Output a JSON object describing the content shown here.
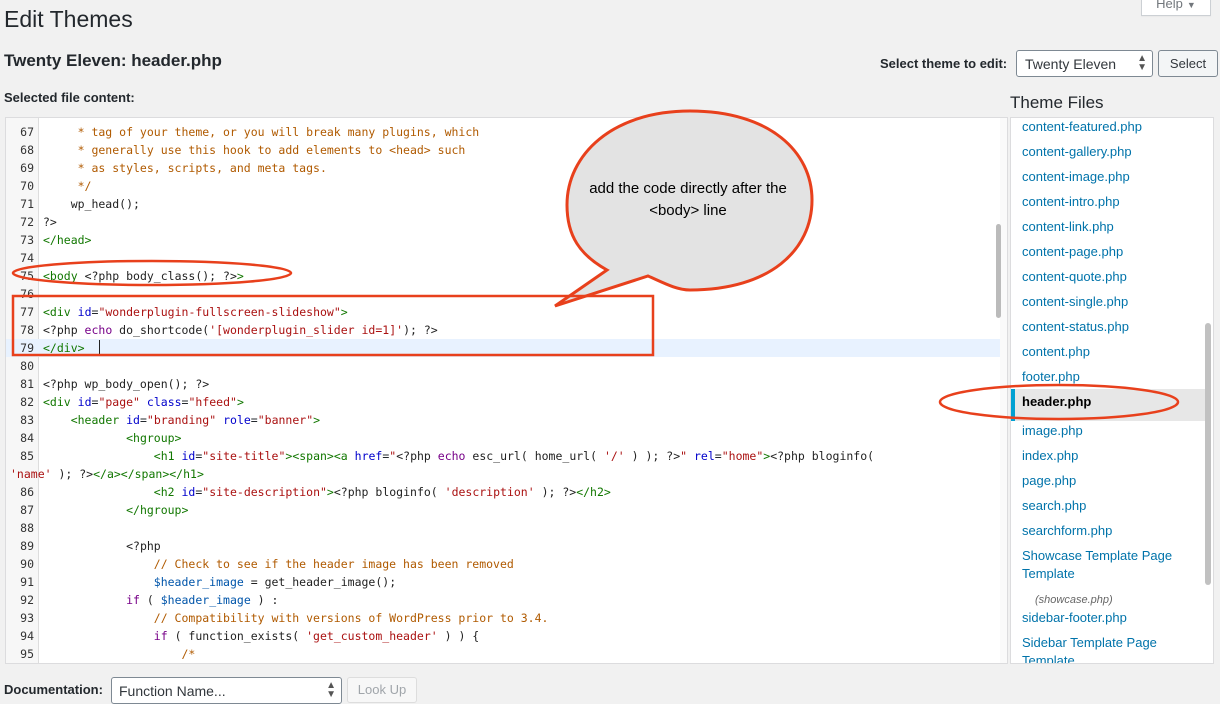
{
  "header": {
    "title": "Edit Themes",
    "help_label": "Help",
    "file_title": "Twenty Eleven: header.php",
    "select_theme_label": "Select theme to edit:",
    "selected_theme": "Twenty Eleven",
    "select_button": "Select",
    "content_label": "Selected file content:"
  },
  "editor": {
    "lines": [
      {
        "n": "67",
        "html": "<span class=\"t-c\">     * tag of your theme, or you will break many plugins, which</span>"
      },
      {
        "n": "68",
        "html": "<span class=\"t-c\">     * generally use this hook to add elements to &lt;head&gt; such</span>"
      },
      {
        "n": "69",
        "html": "<span class=\"t-c\">     * as styles, scripts, and meta tags.</span>"
      },
      {
        "n": "70",
        "html": "<span class=\"t-c\">     */</span>"
      },
      {
        "n": "71",
        "html": "<span class=\"t-def\">    wp_head();</span>"
      },
      {
        "n": "72",
        "html": "<span class=\"t-def\">?&gt;</span>"
      },
      {
        "n": "73",
        "html": "<span class=\"t-tag\">&lt;/head&gt;</span>"
      },
      {
        "n": "74",
        "html": ""
      },
      {
        "n": "75",
        "html": "<span class=\"t-tag\">&lt;body</span> <span class=\"t-def\">&lt;?php body_class(); ?&gt;</span><span class=\"t-tag\">&gt;</span>"
      },
      {
        "n": "76",
        "html": ""
      },
      {
        "n": "77",
        "html": "<span class=\"t-tag\">&lt;div</span> <span class=\"t-attr\">id</span>=<span class=\"t-str\">\"wonderplugin-fullscreen-slideshow\"</span><span class=\"t-tag\">&gt;</span>"
      },
      {
        "n": "78",
        "html": "<span class=\"t-def\">&lt;?php </span><span class=\"t-kw\">echo</span><span class=\"t-def\"> do_shortcode(</span><span class=\"t-str\">'[wonderplugin_slider id=1]'</span><span class=\"t-def\">); ?&gt;</span>"
      },
      {
        "n": "79",
        "html": "<span class=\"t-tag\">&lt;/div&gt;</span>",
        "active": true
      },
      {
        "n": "80",
        "html": ""
      },
      {
        "n": "81",
        "html": "<span class=\"t-def\">&lt;?php wp_body_open(); ?&gt;</span>"
      },
      {
        "n": "82",
        "html": "<span class=\"t-tag\">&lt;div</span> <span class=\"t-attr\">id</span>=<span class=\"t-str\">\"page\"</span> <span class=\"t-attr\">class</span>=<span class=\"t-str\">\"hfeed\"</span><span class=\"t-tag\">&gt;</span>"
      },
      {
        "n": "83",
        "html": "    <span class=\"t-tag\">&lt;header</span> <span class=\"t-attr\">id</span>=<span class=\"t-str\">\"branding\"</span> <span class=\"t-attr\">role</span>=<span class=\"t-str\">\"banner\"</span><span class=\"t-tag\">&gt;</span>"
      },
      {
        "n": "84",
        "html": "            <span class=\"t-tag\">&lt;hgroup&gt;</span>"
      },
      {
        "n": "85",
        "html": "                <span class=\"t-tag\">&lt;h1</span> <span class=\"t-attr\">id</span>=<span class=\"t-str\">\"site-title\"</span><span class=\"t-tag\">&gt;&lt;span&gt;&lt;a</span> <span class=\"t-attr\">href</span>=<span class=\"t-str\">\"</span><span class=\"t-def\">&lt;?php </span><span class=\"t-kw\">echo</span><span class=\"t-def\"> esc_url( home_url( </span><span class=\"t-str\">'/'</span><span class=\"t-def\"> ) ); ?&gt;</span><span class=\"t-str\">\"</span> <span class=\"t-attr\">rel</span>=<span class=\"t-str\">\"home\"</span><span class=\"t-tag\">&gt;</span><span class=\"t-def\">&lt;?php bloginfo(</span>"
      },
      {
        "n": "",
        "html": "<span class=\"t-str\">'name'</span><span class=\"t-def\"> ); ?&gt;</span><span class=\"t-tag\">&lt;/a&gt;&lt;/span&gt;&lt;/h1&gt;</span>",
        "wrap": true
      },
      {
        "n": "86",
        "html": "                <span class=\"t-tag\">&lt;h2</span> <span class=\"t-attr\">id</span>=<span class=\"t-str\">\"site-description\"</span><span class=\"t-tag\">&gt;</span><span class=\"t-def\">&lt;?php bloginfo( </span><span class=\"t-str\">'description'</span><span class=\"t-def\"> ); ?&gt;</span><span class=\"t-tag\">&lt;/h2&gt;</span>"
      },
      {
        "n": "87",
        "html": "            <span class=\"t-tag\">&lt;/hgroup&gt;</span>"
      },
      {
        "n": "88",
        "html": ""
      },
      {
        "n": "89",
        "html": "            <span class=\"t-def\">&lt;?php</span>"
      },
      {
        "n": "90",
        "html": "                <span class=\"t-c\">// Check to see if the header image has been removed</span>"
      },
      {
        "n": "91",
        "html": "                <span class=\"t-var\">$header_image</span><span class=\"t-def\"> = get_header_image();</span>"
      },
      {
        "n": "92",
        "html": "            <span class=\"t-kw\">if</span><span class=\"t-def\"> ( </span><span class=\"t-var\">$header_image</span><span class=\"t-def\"> ) :</span>"
      },
      {
        "n": "93",
        "html": "                <span class=\"t-c\">// Compatibility with versions of WordPress prior to 3.4.</span>"
      },
      {
        "n": "94",
        "html": "                <span class=\"t-kw\">if</span><span class=\"t-def\"> ( function_exists( </span><span class=\"t-str\">'get_custom_header'</span><span class=\"t-def\"> ) ) {</span>"
      },
      {
        "n": "95",
        "html": "                    <span class=\"t-c\">/*</span>"
      }
    ]
  },
  "theme_files": {
    "title": "Theme Files",
    "items": [
      {
        "label": "content-featured.php"
      },
      {
        "label": "content-gallery.php"
      },
      {
        "label": "content-image.php"
      },
      {
        "label": "content-intro.php"
      },
      {
        "label": "content-link.php"
      },
      {
        "label": "content-page.php"
      },
      {
        "label": "content-quote.php"
      },
      {
        "label": "content-single.php"
      },
      {
        "label": "content-status.php"
      },
      {
        "label": "content.php"
      },
      {
        "label": "footer.php"
      },
      {
        "label": "header.php",
        "current": true
      },
      {
        "label": "image.php"
      },
      {
        "label": "index.php"
      },
      {
        "label": "page.php"
      },
      {
        "label": "search.php"
      },
      {
        "label": "searchform.php"
      },
      {
        "label": "Showcase Template Page Template",
        "sub": "(showcase.php)"
      },
      {
        "label": "sidebar-footer.php"
      },
      {
        "label": "Sidebar Template Page Template"
      }
    ]
  },
  "documentation": {
    "label": "Documentation:",
    "selected": "Function Name...",
    "lookup_button": "Look Up"
  },
  "annotation": {
    "callout_text": "add the code directly after the <body> line",
    "color": "#e8401c"
  }
}
